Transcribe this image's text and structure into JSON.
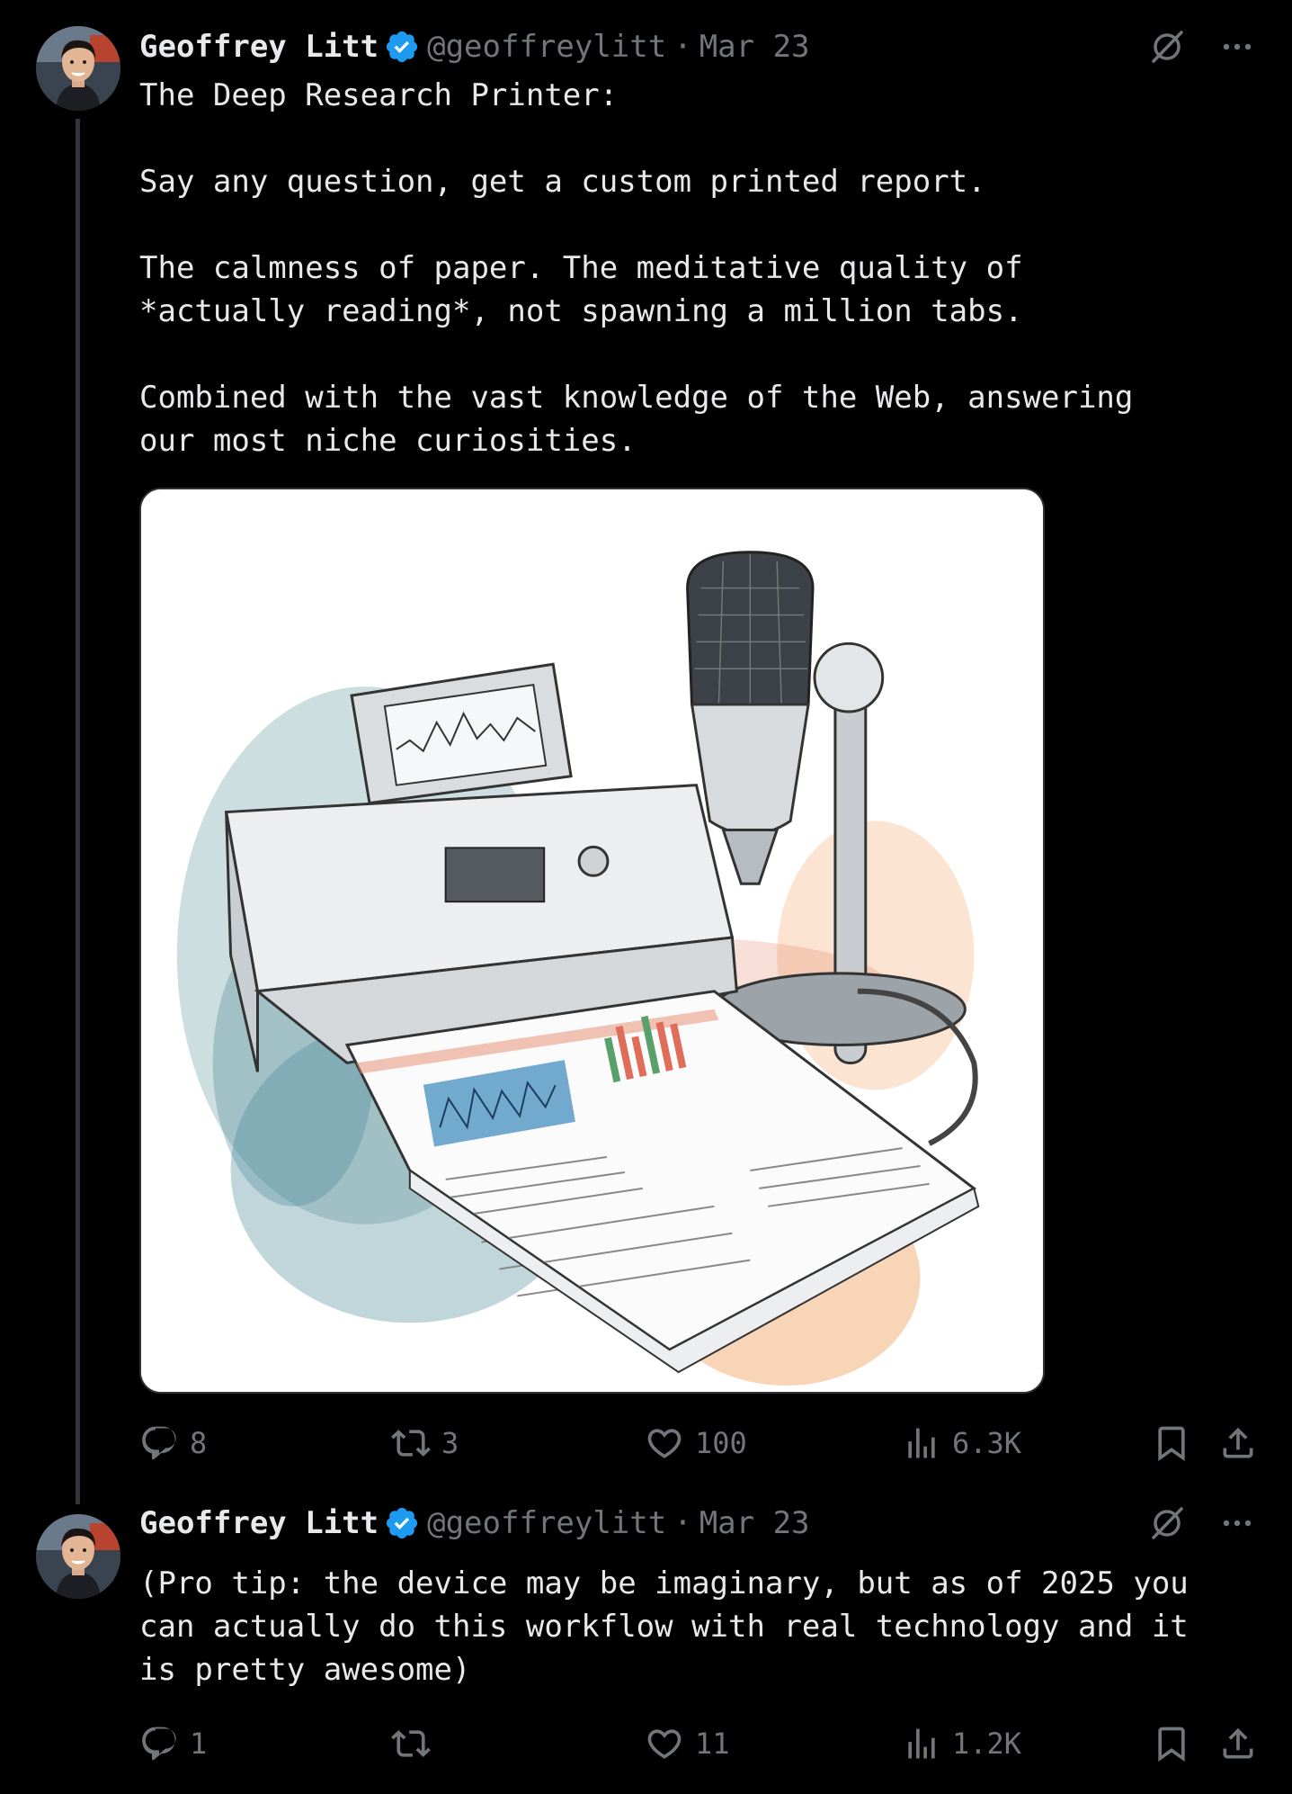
{
  "tweets": [
    {
      "author_name": "Geoffrey Litt",
      "handle": "@geoffreylitt",
      "separator": "·",
      "date": "Mar 23",
      "text": "The Deep Research Printer:\n\nSay any question, get a custom printed report.\n\nThe calmness of paper. The meditative quality of\n*actually reading*, not spawning a million tabs.\n\nCombined with the vast knowledge of the Web, answering\nour most niche curiosities.",
      "media": {
        "kind": "illustration",
        "subject": "printer with microphone printing a report"
      },
      "stats": {
        "replies": "8",
        "retweets": "3",
        "likes": "100",
        "views": "6.3K"
      }
    },
    {
      "author_name": "Geoffrey Litt",
      "handle": "@geoffreylitt",
      "separator": "·",
      "date": "Mar 23",
      "text": "(Pro tip: the device may be imaginary, but as of 2025 you\ncan actually do this workflow with real technology and it\nis pretty awesome)",
      "stats": {
        "replies": "1",
        "retweets": "",
        "likes": "11",
        "views": "1.2K"
      }
    }
  ],
  "icons": {
    "verified": "verified-badge-icon",
    "grok": "grok-icon",
    "more": "more-icon",
    "reply": "reply-icon",
    "retweet": "retweet-icon",
    "like": "like-icon",
    "views": "views-icon",
    "bookmark": "bookmark-icon",
    "share": "share-icon"
  },
  "colors": {
    "background": "#000000",
    "text": "#e7e9ea",
    "muted": "#71767b",
    "verified": "#1d9bf0",
    "thread_line": "#333639"
  }
}
